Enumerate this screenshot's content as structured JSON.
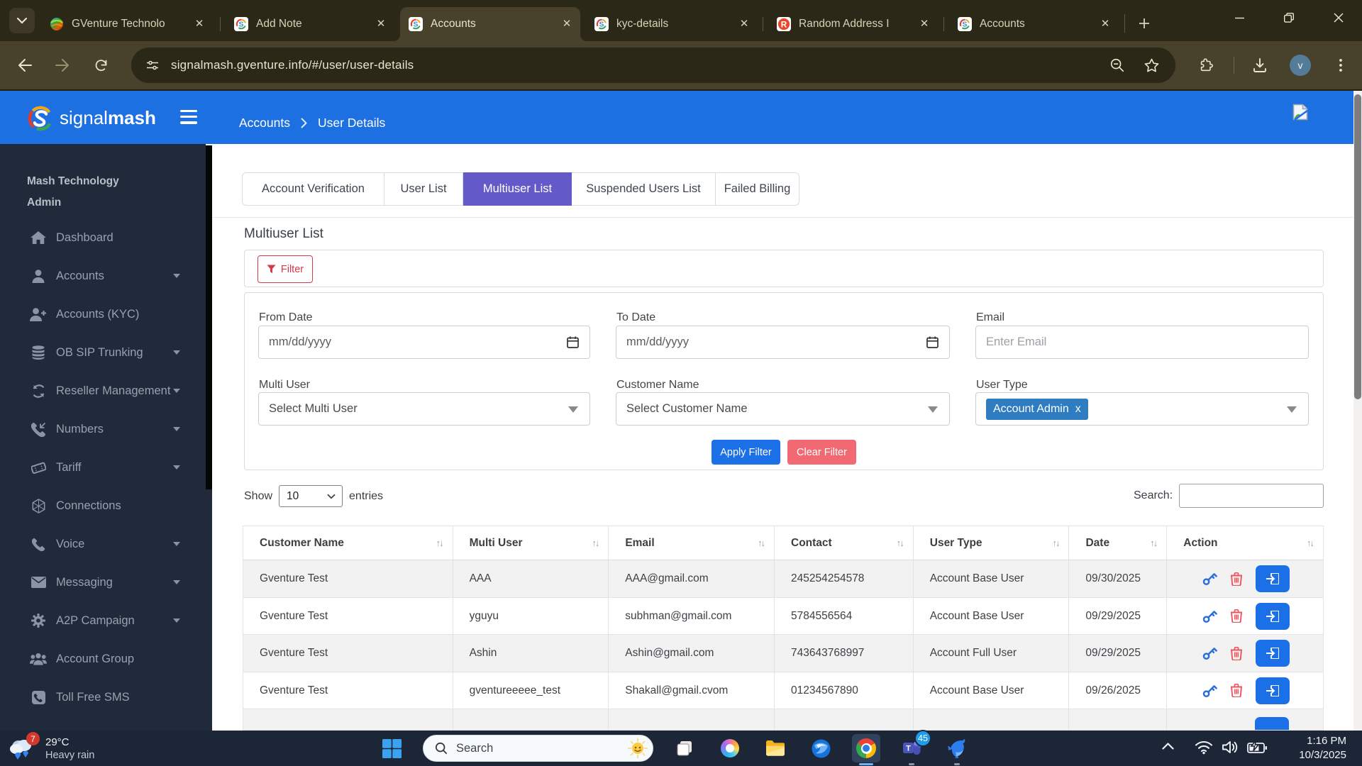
{
  "browser": {
    "tab_search_icon": "chevron-down",
    "tabs": [
      {
        "title": "GVenture Technolo",
        "favicon": "gventure-logo"
      },
      {
        "title": "Add Note",
        "favicon": "signalmash-logo"
      },
      {
        "title": "Accounts",
        "favicon": "signalmash-logo",
        "active": true
      },
      {
        "title": "kyc-details",
        "favicon": "signalmash-logo"
      },
      {
        "title": "Random Address I",
        "favicon": "random-address-logo"
      },
      {
        "title": "Accounts",
        "favicon": "signalmash-logo"
      }
    ],
    "url": "signalmash.gventure.info/#/user/user-details",
    "avatar_letter": "v",
    "colors": {
      "frame": "#2c2817",
      "toolbar": "#48422d",
      "text": "#e9e4cd"
    }
  },
  "app": {
    "brand": {
      "signal": "signal",
      "mash": "mash"
    },
    "breadcrumb": {
      "parent": "Accounts",
      "current": "User Details"
    },
    "header_color": "#1d70e2",
    "sidebar": {
      "heading_line1": "Mash Technology",
      "heading_line2": "Admin",
      "items": [
        {
          "label": "Dashboard",
          "icon": "home-icon",
          "caret": false
        },
        {
          "label": "Accounts",
          "icon": "user-icon",
          "caret": true
        },
        {
          "label": "Accounts (KYC)",
          "icon": "user-plus-icon",
          "caret": false
        },
        {
          "label": "OB SIP Trunking",
          "icon": "database-icon",
          "caret": true
        },
        {
          "label": "Reseller Management",
          "icon": "sync-icon",
          "caret": true
        },
        {
          "label": "Numbers",
          "icon": "phone-in-icon",
          "caret": true
        },
        {
          "label": "Tariff",
          "icon": "tag-icon",
          "caret": true
        },
        {
          "label": "Connections",
          "icon": "globe-wire-icon",
          "caret": false
        },
        {
          "label": "Voice",
          "icon": "phone-icon",
          "caret": true
        },
        {
          "label": "Messaging",
          "icon": "envelope-icon",
          "caret": true
        },
        {
          "label": "A2P Campaign",
          "icon": "gear-icon",
          "caret": true
        },
        {
          "label": "Account Group",
          "icon": "users-icon",
          "caret": false
        },
        {
          "label": "Toll Free SMS",
          "icon": "phone-square-icon",
          "caret": false
        }
      ]
    },
    "tabs": {
      "items": [
        "Account Verification",
        "User List",
        "Multiuser List",
        "Suspended Users List",
        "Failed Billing"
      ],
      "active_index": 2,
      "active_color": "#6459c8"
    },
    "page_title": "Multiuser List",
    "filter": {
      "button_label": "Filter",
      "from_date": {
        "label": "From Date",
        "placeholder": "mm/dd/yyyy"
      },
      "to_date": {
        "label": "To Date",
        "placeholder": "mm/dd/yyyy"
      },
      "email": {
        "label": "Email",
        "placeholder": "Enter Email"
      },
      "multi_user": {
        "label": "Multi User",
        "value": "Select Multi User"
      },
      "customer_name": {
        "label": "Customer Name",
        "value": "Select Customer Name"
      },
      "user_type": {
        "label": "User Type",
        "chip": "Account Admin",
        "chip_remove": "x",
        "chip_color": "#2f7cc0"
      },
      "apply_label": "Apply Filter",
      "clear_label": "Clear Filter"
    },
    "table": {
      "show_label": "Show",
      "page_size": "10",
      "entries_label": "entries",
      "search_label": "Search:",
      "columns": [
        "Customer Name",
        "Multi User",
        "Email",
        "Contact",
        "User Type",
        "Date",
        "Action"
      ],
      "rows": [
        {
          "customer": "Gventure Test",
          "multi_user": "AAA",
          "email": "AAA@gmail.com",
          "contact": "245254254578",
          "user_type": "Account Base User",
          "date": "09/30/2025"
        },
        {
          "customer": "Gventure Test",
          "multi_user": "yguyu",
          "email": "subhman@gmail.com",
          "contact": "5784556564",
          "user_type": "Account Base User",
          "date": "09/29/2025"
        },
        {
          "customer": "Gventure Test",
          "multi_user": "Ashin",
          "email": "Ashin@gmail.com",
          "contact": "743643768997",
          "user_type": "Account Full User",
          "date": "09/29/2025"
        },
        {
          "customer": "Gventure Test",
          "multi_user": "gventureeeee_test",
          "email": "Shakall@gmail.cvom",
          "contact": "01234567890",
          "user_type": "Account Base User",
          "date": "09/26/2025"
        }
      ]
    }
  },
  "taskbar": {
    "weather": {
      "badge": "7",
      "temp": "29°C",
      "condition": "Heavy rain"
    },
    "search_placeholder": "Search",
    "teams_badge": "45",
    "clock": {
      "time": "1:16 PM",
      "date": "10/3/2025"
    }
  }
}
